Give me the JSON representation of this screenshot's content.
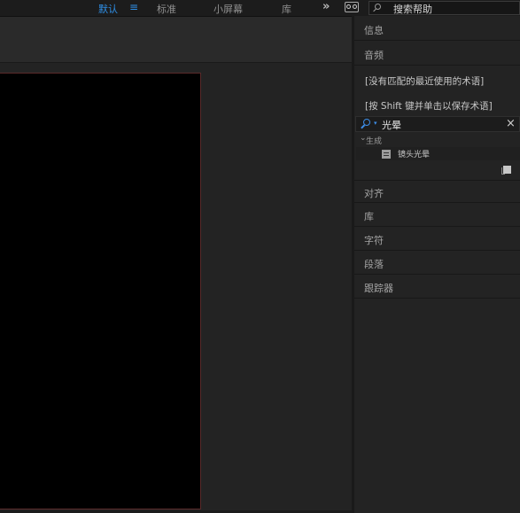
{
  "workspace_bar": {
    "default": "默认",
    "menu_icon": "≡",
    "standard": "标准",
    "small_screen": "小屏幕",
    "library": "库",
    "overflow_icon": "»",
    "search_help_placeholder": "搜索帮助"
  },
  "panels": {
    "info": "信息",
    "audio": "音频",
    "effects": {
      "hint_no_recent": "[没有匹配的最近使用的术语]",
      "hint_shift_save": "[按 Shift 键并单击以保存术语]",
      "search_value": "光晕",
      "clear_icon": "×",
      "category": "生成",
      "result_effect": "镜头光晕"
    },
    "align": "对齐",
    "libraries": "库",
    "character": "字符",
    "paragraph": "段落",
    "tracker": "跟踪器"
  },
  "colors": {
    "accent_blue": "#2f8fe6",
    "panel_bg": "#232323",
    "canvas_bg": "#000000",
    "canvas_border": "#5a2a2a"
  },
  "icons": [
    "menu-icon",
    "chevron-double-right-icon",
    "search-toggle-icon",
    "search-icon",
    "close-icon",
    "chevron-down-icon",
    "effect-icon",
    "new-bin-icon"
  ]
}
